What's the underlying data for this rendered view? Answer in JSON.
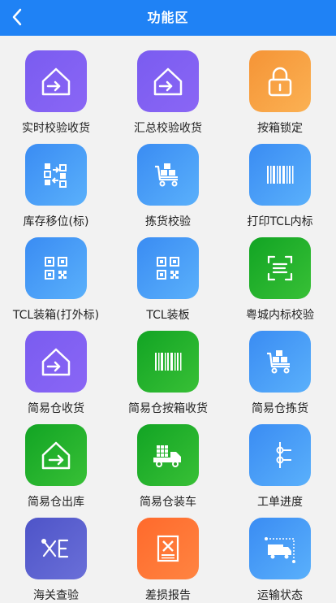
{
  "header": {
    "title": "功能区",
    "back_icon": "chevron-left-icon"
  },
  "colors": {
    "header": "#1f82f5",
    "background": "#f2f2f2"
  },
  "functions": [
    {
      "label": "实时校验收货",
      "icon": "house-arrow-icon",
      "color": "purple"
    },
    {
      "label": "汇总校验收货",
      "icon": "house-arrow-icon",
      "color": "purple"
    },
    {
      "label": "按箱锁定",
      "icon": "lock-icon",
      "color": "orange"
    },
    {
      "label": "库存移位(标)",
      "icon": "stock-move-icon",
      "color": "blue"
    },
    {
      "label": "拣货校验",
      "icon": "cart-boxes-icon",
      "color": "blue"
    },
    {
      "label": "打印TCL内标",
      "icon": "barcode-icon",
      "color": "blue"
    },
    {
      "label": "TCL装箱(打外标)",
      "icon": "qr-code-icon",
      "color": "blue"
    },
    {
      "label": "TCL装板",
      "icon": "qr-code-icon",
      "color": "blue"
    },
    {
      "label": "粤城内标校验",
      "icon": "scan-frame-icon",
      "color": "green"
    },
    {
      "label": "简易仓收货",
      "icon": "house-arrow-icon",
      "color": "purple"
    },
    {
      "label": "简易仓按箱收货",
      "icon": "barcode-icon",
      "color": "green"
    },
    {
      "label": "简易仓拣货",
      "icon": "cart-boxes-icon",
      "color": "blue"
    },
    {
      "label": "简易仓出库",
      "icon": "house-out-icon",
      "color": "green"
    },
    {
      "label": "简易仓装车",
      "icon": "truck-loaded-icon",
      "color": "green"
    },
    {
      "label": "工单进度",
      "icon": "progress-steps-icon",
      "color": "blue"
    },
    {
      "label": "海关查验",
      "icon": "tools-list-icon",
      "color": "indigo"
    },
    {
      "label": "差损报告",
      "icon": "report-x-icon",
      "color": "red"
    },
    {
      "label": "运输状态",
      "icon": "truck-route-icon",
      "color": "blue"
    }
  ]
}
